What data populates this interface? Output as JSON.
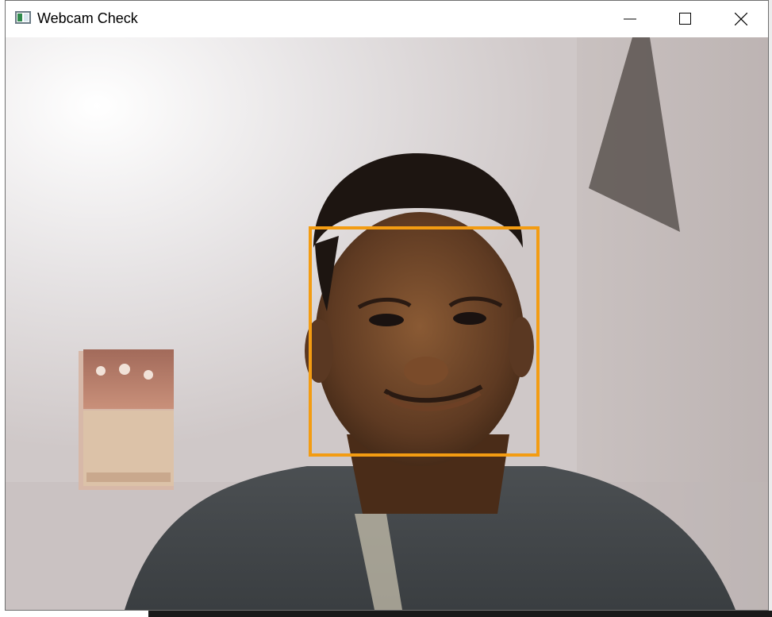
{
  "window": {
    "title": "Webcam Check",
    "icon": "app-window-icon",
    "controls": {
      "minimize_icon": "minimize-icon",
      "maximize_icon": "maximize-icon",
      "close_icon": "close-icon"
    }
  },
  "feed": {
    "detection_box_color": "#f39c12"
  }
}
